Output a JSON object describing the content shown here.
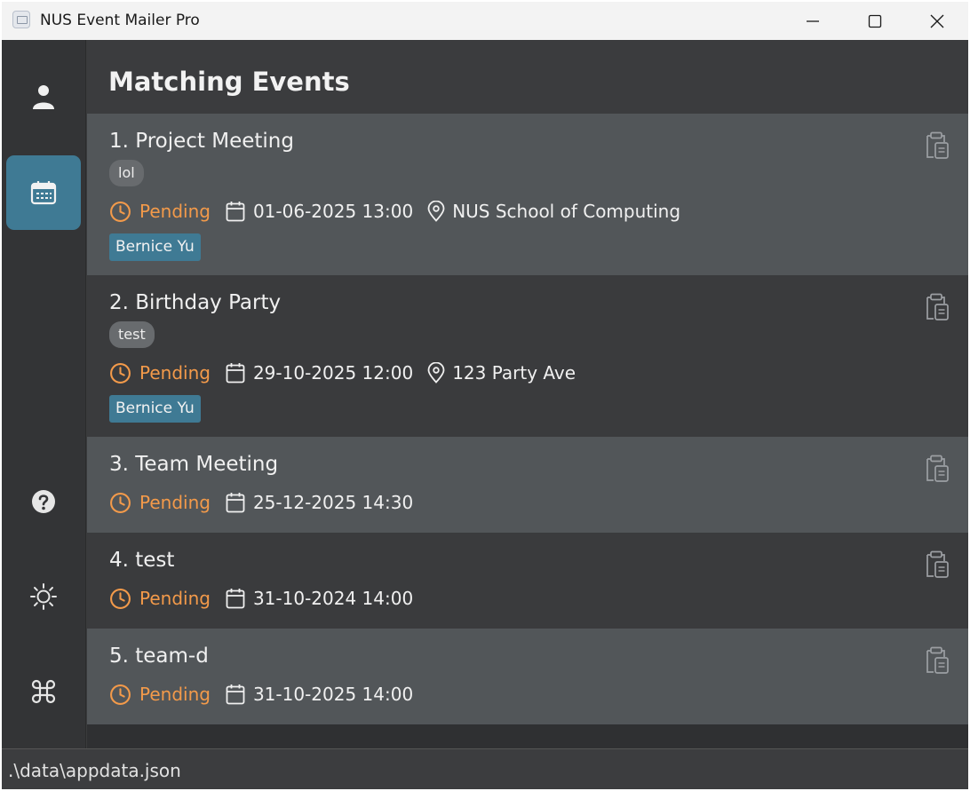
{
  "window": {
    "title": "NUS Event Mailer Pro",
    "icons": {
      "app": "mail-app-icon",
      "minimize": "minimize-icon",
      "maximize": "maximize-icon",
      "close": "close-icon"
    }
  },
  "sidebar": {
    "items": [
      {
        "name": "contacts",
        "icon": "person-icon",
        "active": false
      },
      {
        "name": "events",
        "icon": "calendar-icon",
        "active": true
      },
      {
        "name": "help",
        "icon": "help-icon",
        "active": false
      },
      {
        "name": "theme",
        "icon": "sun-icon",
        "active": false
      },
      {
        "name": "commands",
        "icon": "command-icon",
        "active": false
      }
    ]
  },
  "main": {
    "title": "Matching Events",
    "events": [
      {
        "title": "1. Project Meeting",
        "tag": "lol",
        "status": "Pending",
        "datetime": "01-06-2025 13:00",
        "location": "NUS School of Computing",
        "person": "Bernice Yu"
      },
      {
        "title": "2. Birthday Party",
        "tag": "test",
        "status": "Pending",
        "datetime": "29-10-2025 12:00",
        "location": "123 Party Ave",
        "person": "Bernice Yu"
      },
      {
        "title": "3. Team Meeting",
        "status": "Pending",
        "datetime": "25-12-2025 14:30"
      },
      {
        "title": "4. test",
        "status": "Pending",
        "datetime": "31-10-2024 14:00"
      },
      {
        "title": "5. team-d",
        "status": "Pending",
        "datetime": "31-10-2025 14:00"
      }
    ]
  },
  "statusbar": {
    "path": ".\\data\\appdata.json"
  },
  "colors": {
    "accent": "#3f7a94",
    "pending": "#f39a4a",
    "card_light": "#525659",
    "card_dark": "#3a3b3d"
  }
}
